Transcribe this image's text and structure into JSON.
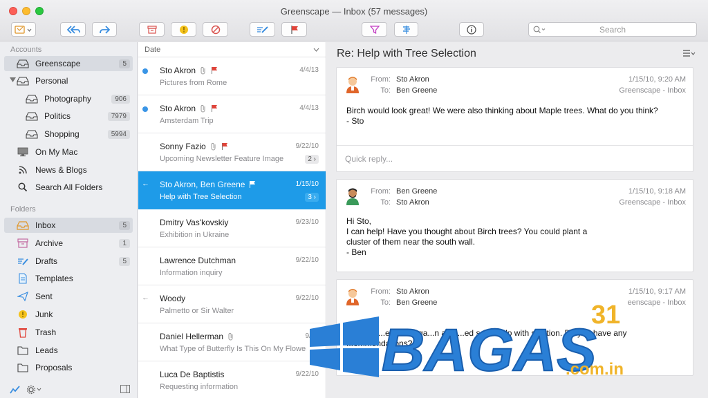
{
  "window": {
    "title": "Greenscape — Inbox (57 messages)"
  },
  "toolbar": {
    "search_placeholder": "Search",
    "buttons": [
      "compose-icon",
      "reply-all-icon",
      "forward-icon",
      "archive-icon",
      "junk-icon",
      "block-icon",
      "edit-icon",
      "flag-icon",
      "filter-icon",
      "tag-icon",
      "info-icon"
    ]
  },
  "sidebar": {
    "accounts_header": "Accounts",
    "folders_header": "Folders",
    "accounts": [
      {
        "label": "Greenscape",
        "count": "5",
        "icon": "inbox-tray-icon"
      },
      {
        "label": "Personal",
        "count": "",
        "icon": "inbox-tray-icon"
      },
      {
        "label": "Photography",
        "count": "906",
        "icon": "inbox-tray-icon"
      },
      {
        "label": "Politics",
        "count": "7979",
        "icon": "inbox-tray-icon"
      },
      {
        "label": "Shopping",
        "count": "5994",
        "icon": "inbox-tray-icon"
      },
      {
        "label": "On My Mac",
        "count": "",
        "icon": "computer-icon"
      },
      {
        "label": "News & Blogs",
        "count": "",
        "icon": "rss-icon"
      },
      {
        "label": "Search All Folders",
        "count": "",
        "icon": "search-icon"
      }
    ],
    "folders": [
      {
        "label": "Inbox",
        "count": "5",
        "icon": "inbox-icon"
      },
      {
        "label": "Archive",
        "count": "1",
        "icon": "archive-icon"
      },
      {
        "label": "Drafts",
        "count": "5",
        "icon": "drafts-icon"
      },
      {
        "label": "Templates",
        "count": "",
        "icon": "templates-icon"
      },
      {
        "label": "Sent",
        "count": "",
        "icon": "sent-icon"
      },
      {
        "label": "Junk",
        "count": "",
        "icon": "junk-icon"
      },
      {
        "label": "Trash",
        "count": "",
        "icon": "trash-icon"
      },
      {
        "label": "Leads",
        "count": "",
        "icon": "folder-icon"
      },
      {
        "label": "Proposals",
        "count": "",
        "icon": "folder-icon"
      }
    ]
  },
  "list": {
    "sort_label": "Date",
    "messages": [
      {
        "from": "Sto Akron",
        "date": "4/4/13",
        "subject": "Pictures from Rome",
        "unread": true,
        "attachment": true,
        "flag": true,
        "thread": "",
        "replied": false
      },
      {
        "from": "Sto Akron",
        "date": "4/4/13",
        "subject": "Amsterdam Trip",
        "unread": true,
        "attachment": true,
        "flag": true,
        "thread": "",
        "replied": false
      },
      {
        "from": "Sonny Fazio",
        "date": "9/22/10",
        "subject": "Upcoming Newsletter Feature Image",
        "unread": false,
        "attachment": true,
        "flag": true,
        "thread": "2",
        "replied": false
      },
      {
        "from": "Sto Akron, Ben Greene",
        "date": "1/15/10",
        "subject": "Help with Tree Selection",
        "unread": false,
        "attachment": false,
        "flag": true,
        "thread": "3",
        "replied": true
      },
      {
        "from": "Dmitry Vas'kovskiy",
        "date": "9/23/10",
        "subject": "Exhibition in Ukraine",
        "unread": false,
        "attachment": false,
        "flag": false,
        "thread": "",
        "replied": false
      },
      {
        "from": "Lawrence Dutchman",
        "date": "9/22/10",
        "subject": "Information inquiry",
        "unread": false,
        "attachment": false,
        "flag": false,
        "thread": "",
        "replied": false
      },
      {
        "from": "Woody",
        "date": "9/22/10",
        "subject": "Palmetto or Sir Walter",
        "unread": false,
        "attachment": false,
        "flag": false,
        "thread": "",
        "replied": true
      },
      {
        "from": "Daniel Hellerman",
        "date": "9/22",
        "subject": "What Type of Butterfly Is This On My Flower",
        "unread": false,
        "attachment": true,
        "flag": false,
        "thread": "",
        "replied": false
      },
      {
        "from": "Luca De Baptistis",
        "date": "9/22/10",
        "subject": "Requesting information",
        "unread": false,
        "attachment": false,
        "flag": false,
        "thread": "",
        "replied": false
      }
    ]
  },
  "reader": {
    "title": "Re: Help with Tree Selection",
    "from_label": "From:",
    "to_label": "To:",
    "quick_reply_placeholder": "Quick reply...",
    "messages": [
      {
        "from": "Sto Akron",
        "to": "Ben Greene",
        "datetime": "1/15/10, 9:20 AM",
        "mailbox": "Greenscape - Inbox",
        "body": "Birch would look great!  We were also thinking about Maple trees.  What do you think?\n- Sto"
      },
      {
        "from": "Ben Greene",
        "to": "Sto Akron",
        "datetime": "1/15/10, 9:18 AM",
        "mailbox": "Greenscape - Inbox",
        "body": "Hi Sto,\nI can help!  Have you thought about Birch trees?  You could plant a\ncluster of them near the south wall.\n- Ben"
      },
      {
        "from": "Sto Akron",
        "to": "Ben Greene",
        "datetime": "1/15/10, 9:17 AM",
        "mailbox": "eenscape - Inbox",
        "body": "...ting ne...es in my ga...n and ...ed some ...lp with s...ction.  Do you have any\n...ommendations?\n...Akron"
      }
    ]
  },
  "watermark": {
    "brand": "BAGAS",
    "number": "31",
    "domain": ".com.in"
  },
  "colors": {
    "selection": "#1e9be8",
    "unread_dot": "#3a95e6",
    "flag": "#e0443a",
    "watermark_blue": "#2a7fd6",
    "watermark_gold": "#f0b42a"
  }
}
